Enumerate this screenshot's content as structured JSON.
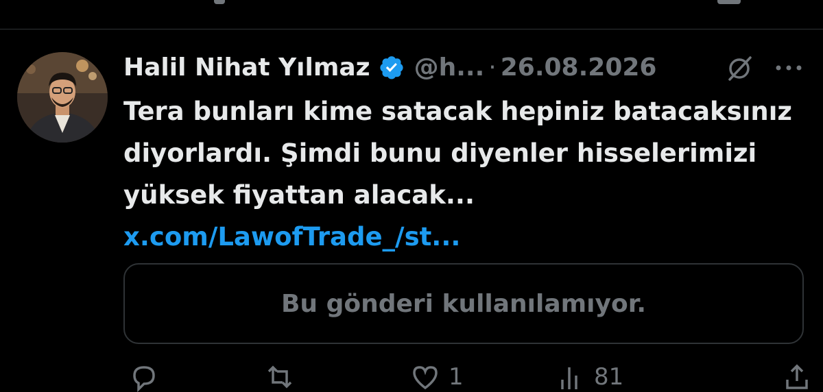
{
  "tweet": {
    "author_name": "Halil Nihat Yılmaz",
    "handle": "@h...",
    "separator": "·",
    "date": "26.08.2026",
    "text": "Tera bunları kime satacak hepiniz batacaksınız diyorlardı. Şimdi bunu diyenler hisselerimizi yüksek fiyattan alacak... ",
    "link": "x.com/LawofTrade_/st...",
    "quoted_unavailable": "Bu gönderi kullanılamıyor.",
    "like_count": "1",
    "view_count": "81"
  },
  "icons": {
    "verified": "verified-badge-icon",
    "grok": "grok-icon",
    "more": "more-icon",
    "reply": "reply-icon",
    "retweet": "retweet-icon",
    "like": "like-icon",
    "views": "views-icon",
    "share": "share-icon"
  },
  "colors": {
    "background": "#000000",
    "text": "#e7e9ea",
    "muted": "#71767b",
    "link": "#1d9bf0",
    "verified": "#1d9bf0",
    "border": "#2f3336"
  }
}
